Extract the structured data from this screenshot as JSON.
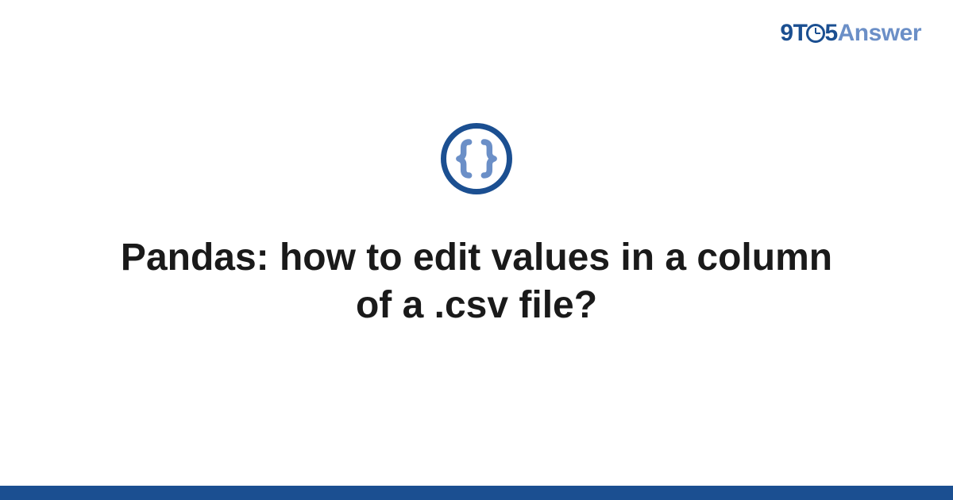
{
  "logo": {
    "part1": "9T",
    "part2": "5",
    "part3": "Answer"
  },
  "icon": {
    "name": "code-braces-icon"
  },
  "title": "Pandas: how to edit values in a column of a .csv file?",
  "colors": {
    "primary": "#1b4f91",
    "secondary": "#6b8fc7"
  }
}
